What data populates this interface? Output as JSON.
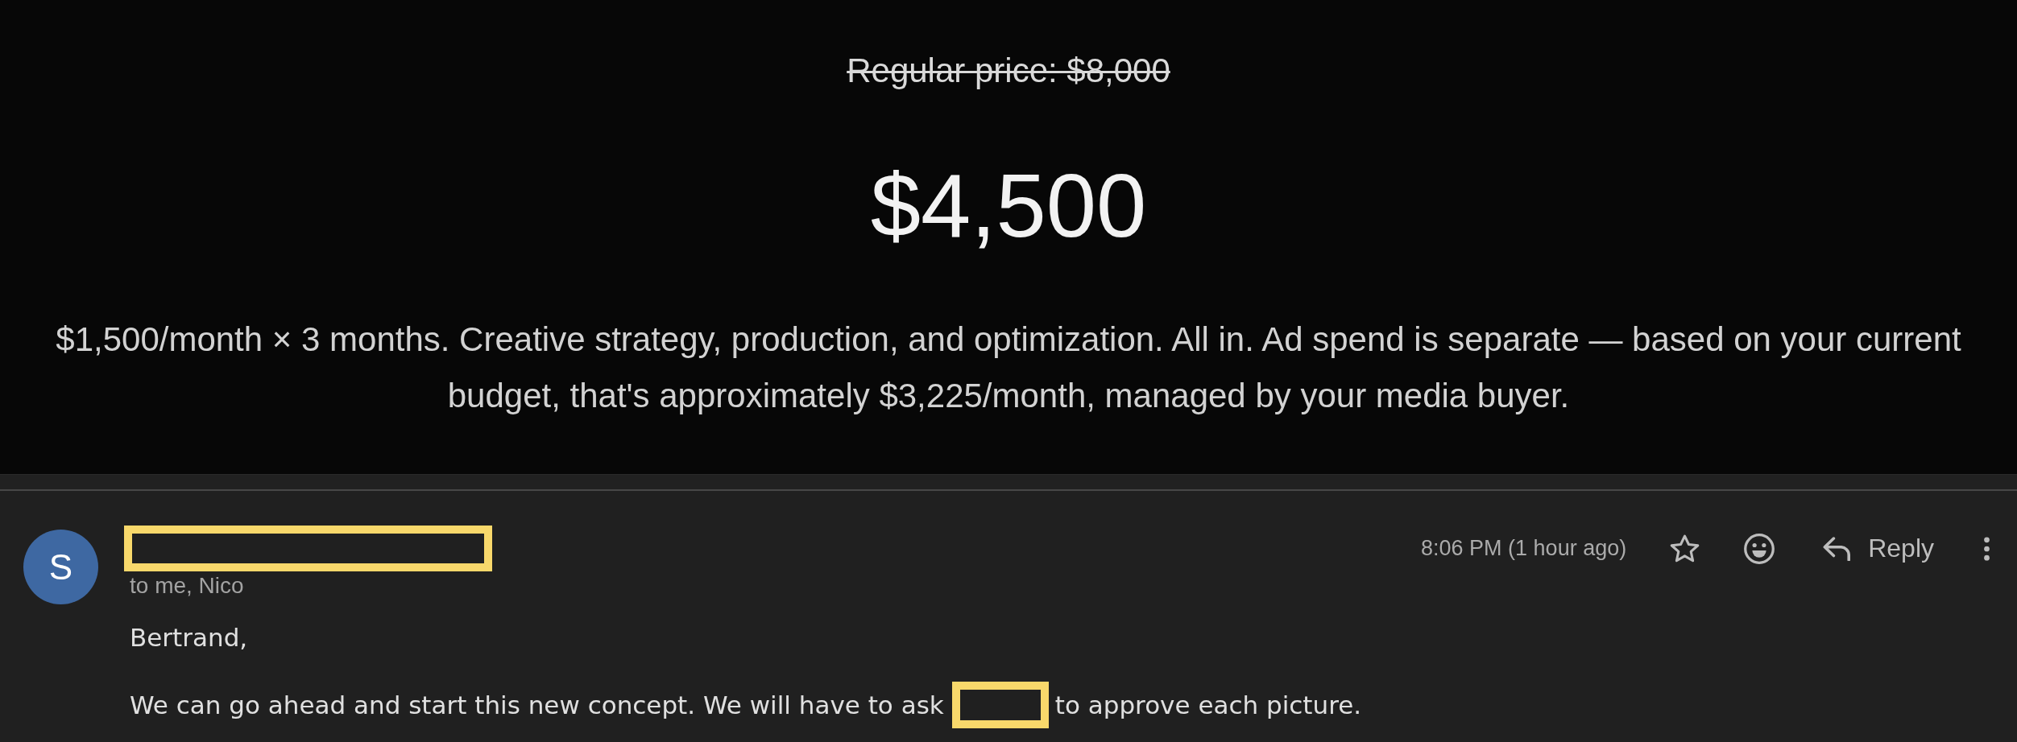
{
  "offer": {
    "regular_price": {
      "text": "Regular price: $8,000",
      "struck": true
    },
    "price": "$4,500",
    "description": "$1,500/month × 3 months. Creative strategy, production, and optimization. All in. Ad spend is separate — based on your current budget, that's approximately $3,225/month, managed by your media buyer."
  },
  "message": {
    "avatar_letter": "S",
    "sender_redacted": true,
    "recipients": "to me, Nico",
    "time": "8:06 PM (1 hour ago)",
    "starred": false,
    "reply_label": "Reply",
    "body": [
      {
        "parts": [
          {
            "kind": "text",
            "text": "Bertrand,"
          }
        ]
      },
      {
        "parts": [
          {
            "kind": "text",
            "text": "We can go ahead and start this new concept. We will have to ask"
          },
          {
            "kind": "redaction"
          },
          {
            "kind": "text",
            "text": "to approve each picture."
          }
        ]
      }
    ]
  }
}
